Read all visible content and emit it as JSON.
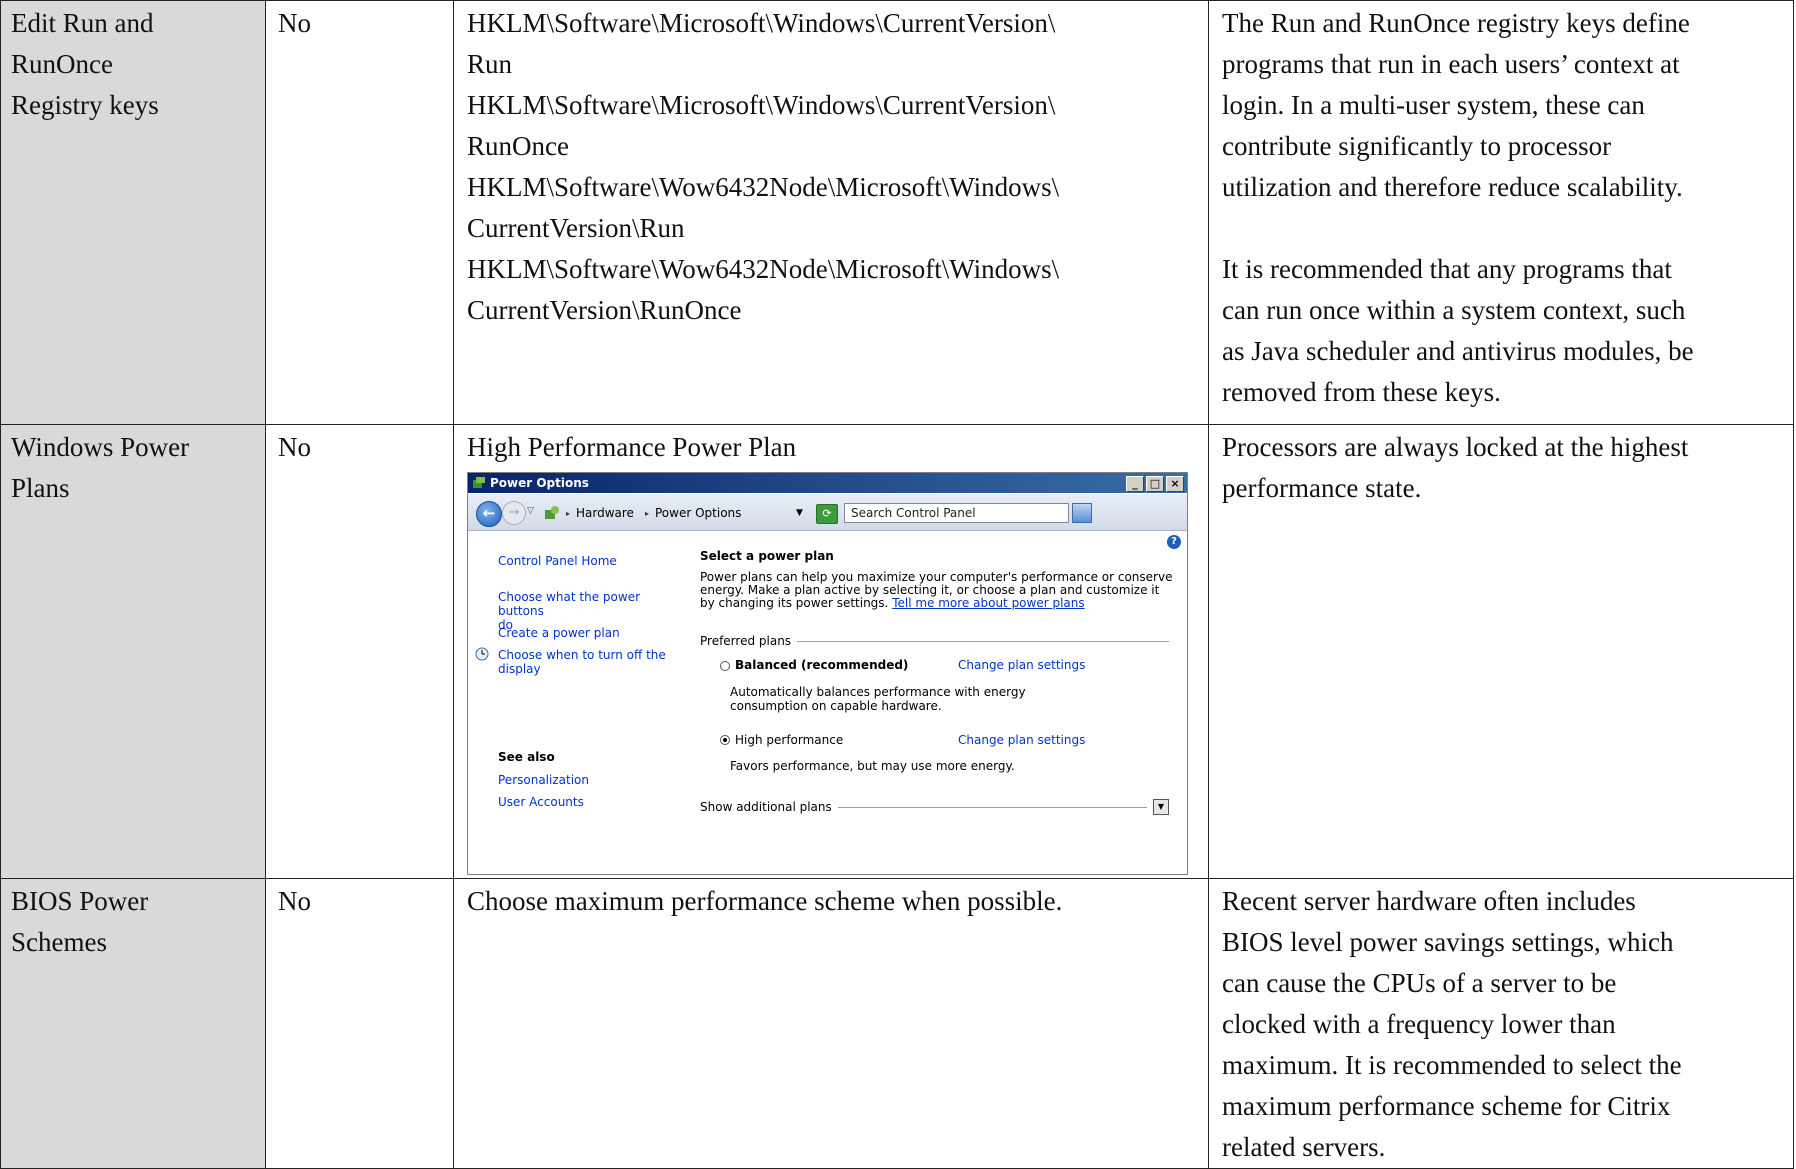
{
  "rows": [
    {
      "name_lines": [
        "Edit Run and",
        "RunOnce",
        "Registry keys"
      ],
      "default": "No",
      "setting_lines": [
        "HKLM\\Software\\Microsoft\\Windows\\CurrentVersion\\",
        "Run",
        "HKLM\\Software\\Microsoft\\Windows\\CurrentVersion\\",
        "RunOnce",
        "HKLM\\Software\\Wow6432Node\\Microsoft\\Windows\\",
        "CurrentVersion\\Run",
        "HKLM\\Software\\Wow6432Node\\Microsoft\\Windows\\",
        "CurrentVersion\\RunOnce"
      ],
      "description": {
        "para1_lines": [
          "The Run and RunOnce registry keys define",
          "programs that run in each users’ context at",
          "login.  In a multi-user system, these can",
          "contribute significantly to processor",
          "utilization and therefore reduce scalability."
        ],
        "para2_lines": [
          "It is recommended that any programs that",
          "can run once within a system context, such",
          "as Java scheduler and antivirus modules, be",
          "removed from these keys."
        ]
      }
    },
    {
      "name_lines": [
        "Windows Power",
        "Plans"
      ],
      "default": "No",
      "setting_title": "High Performance Power Plan",
      "description_lines": [
        "Processors are always locked at the highest",
        "performance state."
      ]
    },
    {
      "name_lines": [
        "BIOS Power",
        "Schemes"
      ],
      "default": "No",
      "setting": "Choose maximum performance scheme when possible.",
      "description_lines": [
        "Recent server hardware often includes",
        "BIOS level power savings settings, which",
        "can cause the CPUs of a server to be",
        "clocked with a frequency lower than",
        "maximum. It is recommended to select the",
        "maximum performance scheme for Citrix",
        "related servers."
      ]
    }
  ],
  "power_options": {
    "window_title": "Power Options",
    "breadcrumb": [
      "Hardware",
      "Power Options"
    ],
    "search_placeholder": "Search Control Panel",
    "left_links": {
      "home": "Control Panel Home",
      "power_buttons": [
        "Choose what the power buttons",
        "do"
      ],
      "create_plan": "Create a power plan",
      "turn_off_display": [
        "Choose when to turn off the",
        "display"
      ]
    },
    "see_also": {
      "heading": "See also",
      "links": [
        "Personalization",
        "User Accounts"
      ]
    },
    "main": {
      "title": "Select a power plan",
      "intro_lines": [
        "Power plans can help you maximize your computer's performance or conserve",
        "energy. Make a plan active by selecting it, or choose a plan and customize it",
        "by changing its power settings. "
      ],
      "intro_link": "Tell me more about power plans",
      "preferred_label": "Preferred plans",
      "plans": [
        {
          "name": "Balanced (recommended)",
          "selected": false,
          "link": "Change plan settings",
          "desc_lines": [
            "Automatically balances performance with energy",
            "consumption on capable hardware."
          ]
        },
        {
          "name": "High performance",
          "selected": true,
          "link": "Change plan settings",
          "desc_lines": [
            "Favors performance, but may use more energy."
          ]
        }
      ],
      "additional_label": "Show additional plans"
    },
    "colors": {
      "link": "#0033cc",
      "title_bar": "#0a246a",
      "name_cell_bg": "#d9d9d9"
    }
  }
}
